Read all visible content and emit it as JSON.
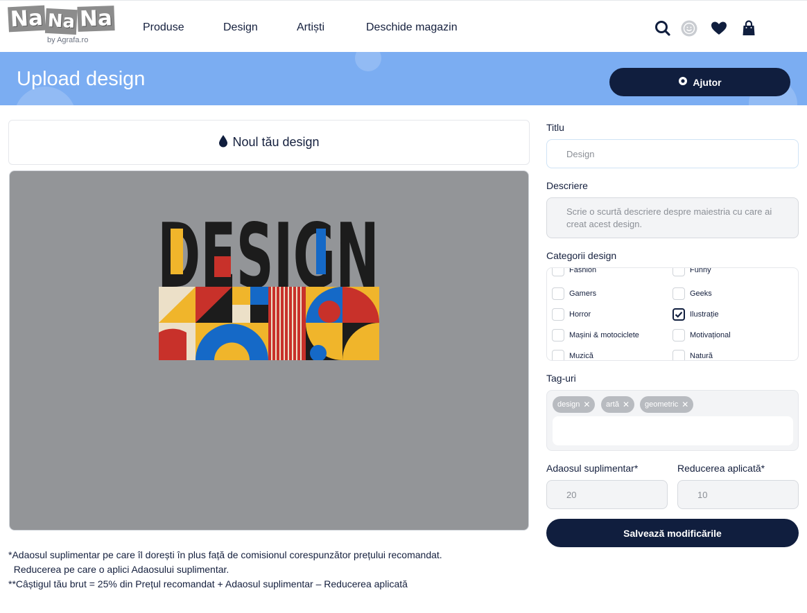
{
  "header": {
    "logo_text": "NaNaNa",
    "logo_letters": [
      "Na",
      "Na",
      "Na",
      "Na"
    ],
    "logo_sub": "by Agrafa.ro",
    "nav": [
      "Produse",
      "Design",
      "Artiști",
      "Deschide magazin"
    ],
    "icons": [
      "search-icon",
      "account-smiley-icon",
      "heart-icon",
      "shopping-bag-icon"
    ]
  },
  "banner": {
    "title": "Upload design",
    "help_label": "Ajutor"
  },
  "left": {
    "design_heading": "Noul tău design",
    "artwork_text": "DESIGN",
    "notes": [
      "*Adaosul suplimentar pe care îl dorești în plus față de comisionul corespunzător prețului recomandat.",
      "  Reducerea pe care o aplici Adaosului suplimentar.",
      "**Câștigul tău brut = 25% din Prețul recomandat + Adaosul suplimentar – Reducerea aplicată"
    ]
  },
  "form": {
    "title_label": "Titlu",
    "title_value": "Design",
    "description_label": "Descriere",
    "description_placeholder": "Scrie o scurtă descriere despre maiestria cu care ai creat acest design.",
    "categories_label": "Categorii design",
    "categories": [
      {
        "label": "Fashion",
        "checked": false
      },
      {
        "label": "Funny",
        "checked": false
      },
      {
        "label": "Gamers",
        "checked": false
      },
      {
        "label": "Geeks",
        "checked": false
      },
      {
        "label": "Horror",
        "checked": false
      },
      {
        "label": "Ilustrație",
        "checked": true
      },
      {
        "label": "Mașini & motociclete",
        "checked": false
      },
      {
        "label": "Motivațional",
        "checked": false
      },
      {
        "label": "Muzică",
        "checked": false
      },
      {
        "label": "Natură",
        "checked": false
      }
    ],
    "tags_label": "Tag-uri",
    "tags": [
      "design",
      "artă",
      "geometric"
    ],
    "markup_label": "Adaosul suplimentar*",
    "markup_value": "20",
    "discount_label": "Reducerea aplicată*",
    "discount_value": "10",
    "save_label": "Salvează modificările"
  },
  "colors": {
    "navy": "#101e3e",
    "banner_blue": "#7badf2",
    "preview_gray": "#939598",
    "art_red": "#c8312a",
    "art_yellow": "#f0b52b",
    "art_blue": "#1569c7",
    "art_black": "#1c1c1c",
    "art_cream": "#ece0c8"
  }
}
